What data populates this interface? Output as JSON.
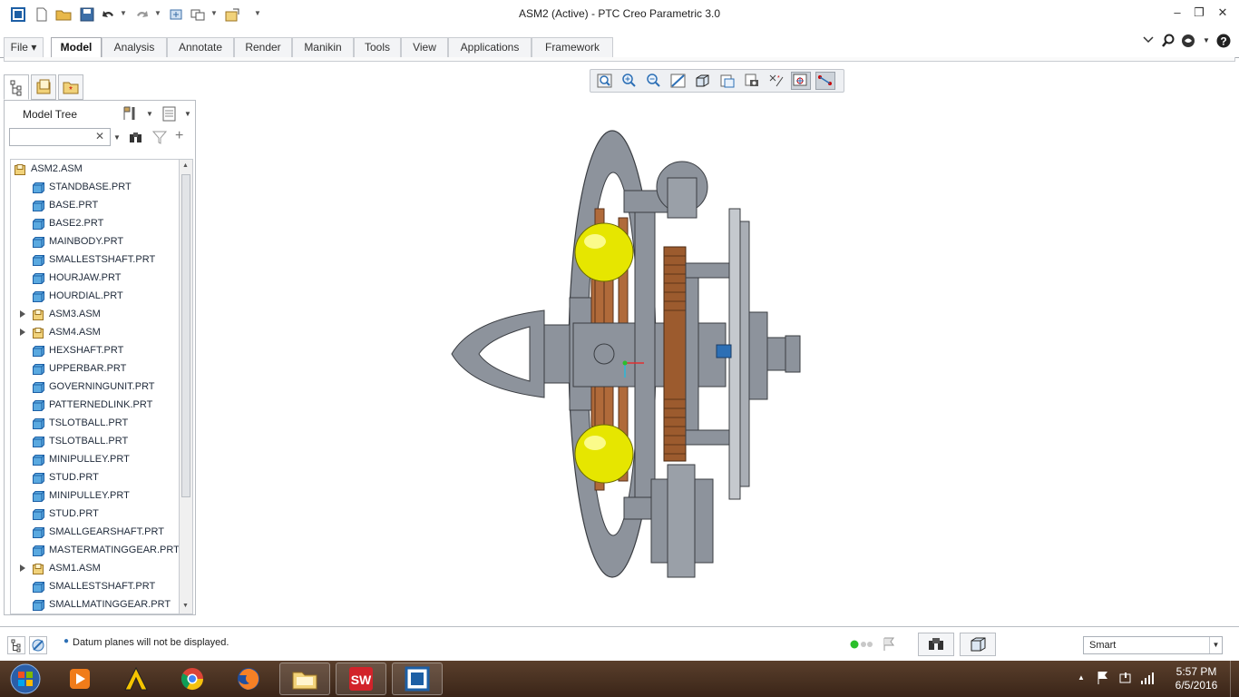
{
  "window": {
    "title": "ASM2 (Active) - PTC Creo Parametric 3.0"
  },
  "ribbon": {
    "tabs": [
      {
        "label": "File"
      },
      {
        "label": "Model"
      },
      {
        "label": "Analysis"
      },
      {
        "label": "Annotate"
      },
      {
        "label": "Render"
      },
      {
        "label": "Manikin"
      },
      {
        "label": "Tools"
      },
      {
        "label": "View"
      },
      {
        "label": "Applications"
      },
      {
        "label": "Framework"
      }
    ],
    "active_tab": "Model"
  },
  "model_tree": {
    "title": "Model Tree",
    "search": {
      "value": "",
      "placeholder": ""
    },
    "items": [
      {
        "label": "ASM2.ASM",
        "type": "assembly",
        "level": 0,
        "expandable": false
      },
      {
        "label": "STANDBASE.PRT",
        "type": "part",
        "level": 1,
        "expandable": false
      },
      {
        "label": "BASE.PRT",
        "type": "part",
        "level": 1,
        "expandable": false
      },
      {
        "label": "BASE2.PRT",
        "type": "part",
        "level": 1,
        "expandable": false
      },
      {
        "label": "MAINBODY.PRT",
        "type": "part",
        "level": 1,
        "expandable": false
      },
      {
        "label": "SMALLESTSHAFT.PRT",
        "type": "part",
        "level": 1,
        "expandable": false
      },
      {
        "label": "HOURJAW.PRT",
        "type": "part",
        "level": 1,
        "expandable": false
      },
      {
        "label": "HOURDIAL.PRT",
        "type": "part",
        "level": 1,
        "expandable": false
      },
      {
        "label": "ASM3.ASM",
        "type": "assembly",
        "level": 1,
        "expandable": true
      },
      {
        "label": "ASM4.ASM",
        "type": "assembly",
        "level": 1,
        "expandable": true
      },
      {
        "label": "HEXSHAFT.PRT",
        "type": "part",
        "level": 1,
        "expandable": false
      },
      {
        "label": "UPPERBAR.PRT",
        "type": "part",
        "level": 1,
        "expandable": false
      },
      {
        "label": "GOVERNINGUNIT.PRT",
        "type": "part",
        "level": 1,
        "expandable": false
      },
      {
        "label": "PATTERNEDLINK.PRT",
        "type": "part",
        "level": 1,
        "expandable": false
      },
      {
        "label": "TSLOTBALL.PRT",
        "type": "part",
        "level": 1,
        "expandable": false
      },
      {
        "label": "TSLOTBALL.PRT",
        "type": "part",
        "level": 1,
        "expandable": false
      },
      {
        "label": "MINIPULLEY.PRT",
        "type": "part",
        "level": 1,
        "expandable": false
      },
      {
        "label": "STUD.PRT",
        "type": "part",
        "level": 1,
        "expandable": false
      },
      {
        "label": "MINIPULLEY.PRT",
        "type": "part",
        "level": 1,
        "expandable": false
      },
      {
        "label": "STUD.PRT",
        "type": "part",
        "level": 1,
        "expandable": false
      },
      {
        "label": "SMALLGEARSHAFT.PRT",
        "type": "part",
        "level": 1,
        "expandable": false
      },
      {
        "label": "MASTERMATINGGEAR.PRT",
        "type": "part",
        "level": 1,
        "expandable": false
      },
      {
        "label": "ASM1.ASM",
        "type": "assembly",
        "level": 1,
        "expandable": true
      },
      {
        "label": "SMALLESTSHAFT.PRT",
        "type": "part",
        "level": 1,
        "expandable": false
      },
      {
        "label": "SMALLMATINGGEAR.PRT",
        "type": "part",
        "level": 1,
        "expandable": false
      }
    ]
  },
  "status": {
    "message": "Datum planes will not be displayed.",
    "filter_value": "Smart"
  },
  "taskbar": {
    "time": "5:57 PM",
    "date": "6/5/2016"
  },
  "colors": {
    "model_gray": "#8d939c",
    "model_dark": "#3a3d42",
    "ball_yellow": "#e6e600",
    "copper": "#b06a3a",
    "accent_blue": "#2c6fb5"
  }
}
